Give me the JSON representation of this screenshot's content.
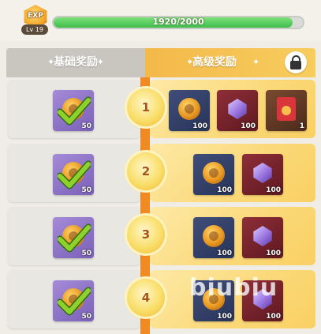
{
  "level": {
    "exp_label": "EXP",
    "level_label": "Lv 19",
    "progress_text": "1920/2000",
    "progress_fraction": 0.96
  },
  "tabs": {
    "basic": "基础奖励",
    "premium": "高级奖励"
  },
  "rows": [
    {
      "number": "1",
      "basic": {
        "count": "50",
        "claimed": true
      },
      "premium": [
        {
          "type": "coin",
          "count": "100"
        },
        {
          "type": "crystal",
          "count": "100"
        },
        {
          "type": "envelope",
          "count": "1"
        }
      ]
    },
    {
      "number": "2",
      "basic": {
        "count": "50",
        "claimed": true
      },
      "premium": [
        {
          "type": "coin",
          "count": "100"
        },
        {
          "type": "crystal",
          "count": "100"
        }
      ]
    },
    {
      "number": "3",
      "basic": {
        "count": "50",
        "claimed": true
      },
      "premium": [
        {
          "type": "coin",
          "count": "100"
        },
        {
          "type": "crystal",
          "count": "100"
        }
      ]
    },
    {
      "number": "4",
      "basic": {
        "count": "50",
        "claimed": true
      },
      "premium": [
        {
          "type": "coin",
          "count": "100"
        },
        {
          "type": "crystal",
          "count": "100"
        }
      ]
    }
  ],
  "watermark": "biubiu",
  "colors": {
    "exp_fill": "#4fc85a",
    "premium_tab": "#f5c252",
    "rail": "#f28a24",
    "check": "#8fd12c"
  },
  "icons": {
    "lock": "lock-icon",
    "check": "check-icon",
    "coin": "coin-icon",
    "crystal": "crystal-icon",
    "envelope": "red-envelope-icon"
  }
}
